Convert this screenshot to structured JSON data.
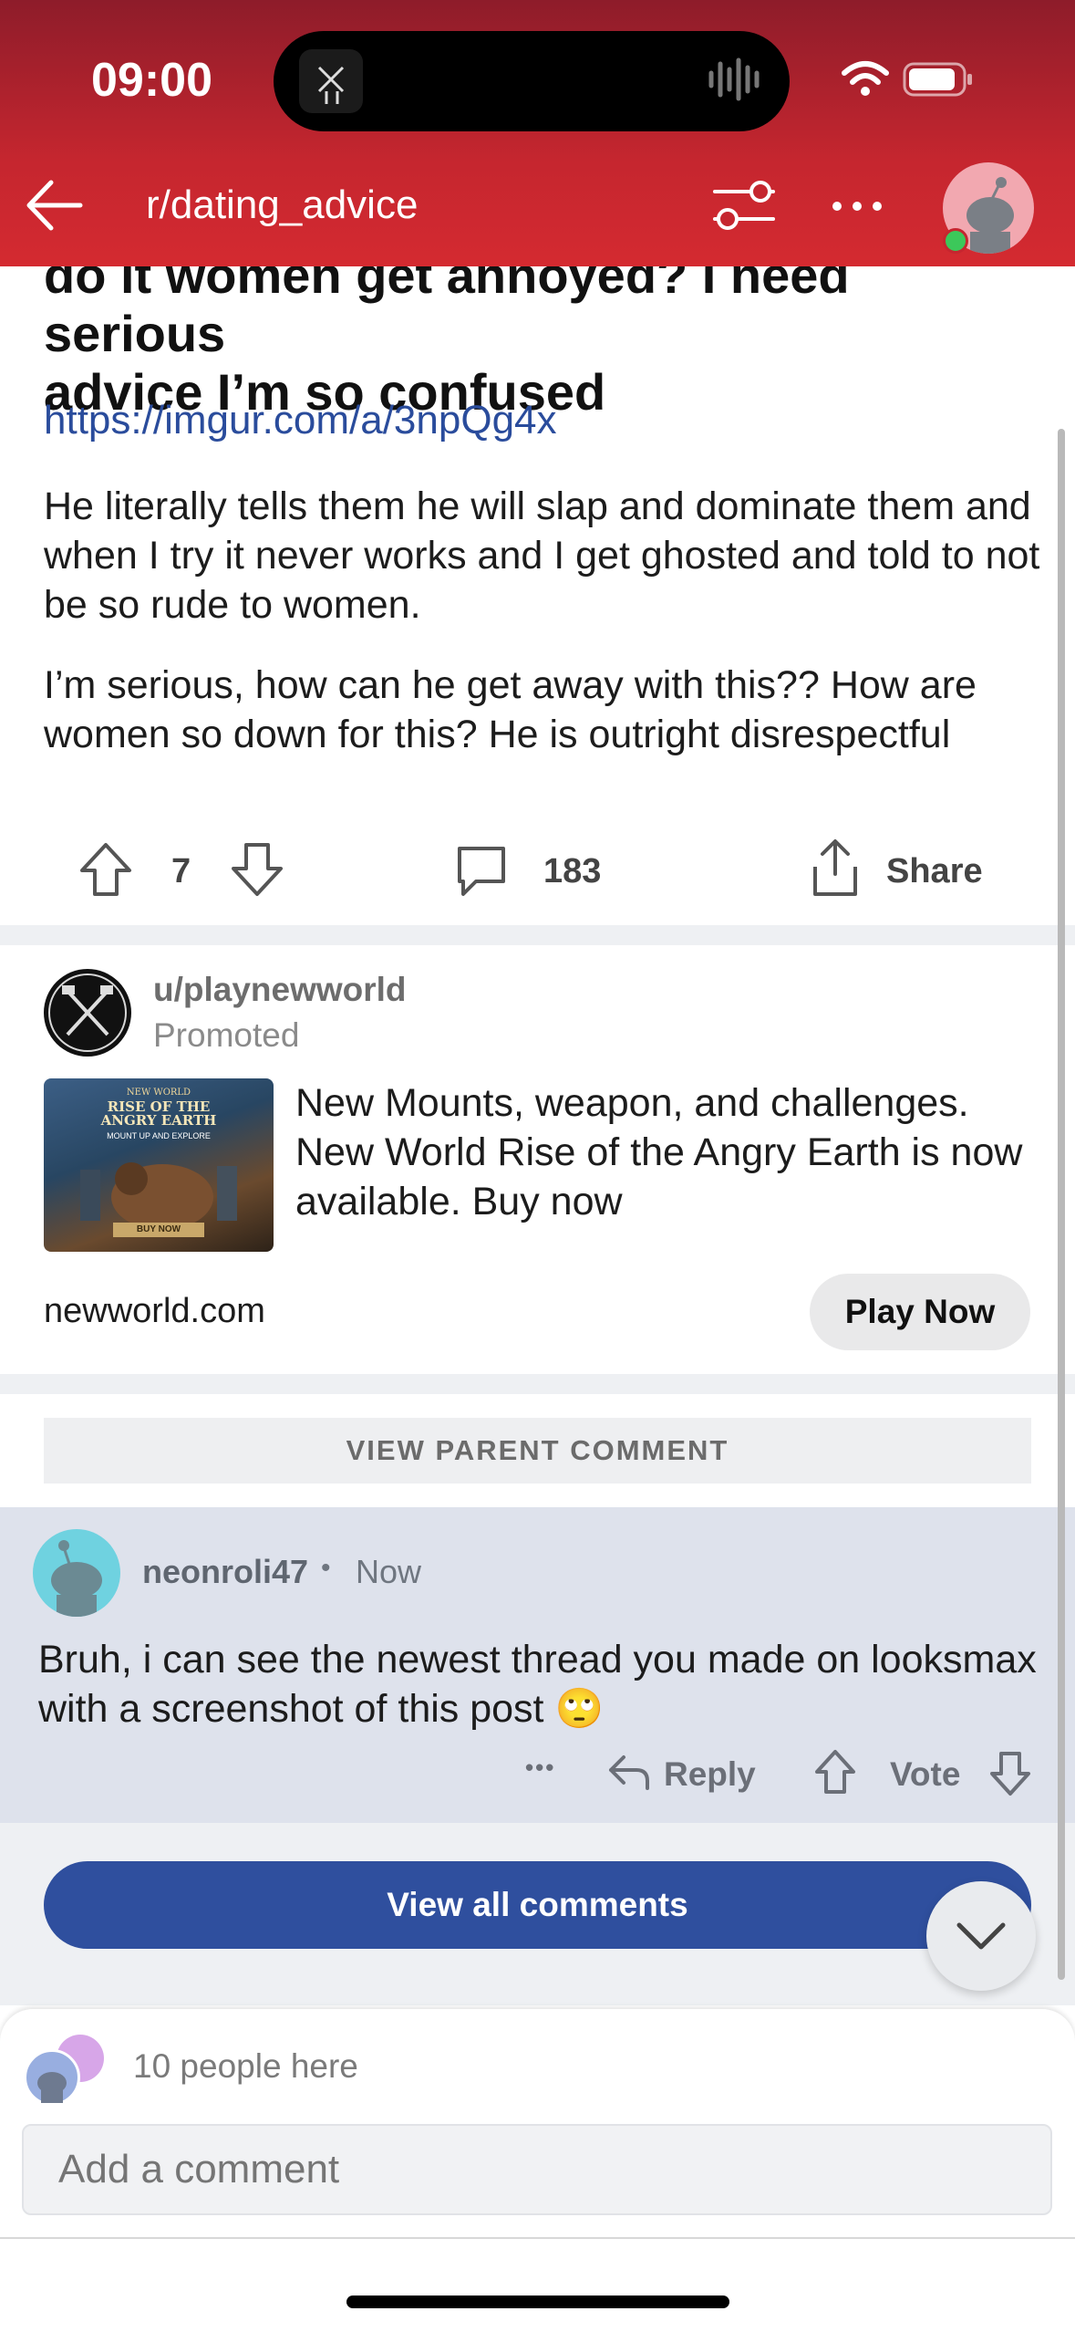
{
  "status_bar": {
    "time": "09:00"
  },
  "header": {
    "subreddit": "r/dating_advice"
  },
  "post": {
    "title_line1": "do it women get annoyed? I need serious",
    "title_line2": "advice I’m so confused",
    "link": "https://imgur.com/a/3npQg4x",
    "paragraph1": "He literally tells them he will slap and dominate them and when I try it never works and I get ghosted and told to not be so rude to women.",
    "paragraph2": "I’m serious, how can he get away with this?? How are women so down for this? He is outright disrespectful",
    "votes": "7",
    "comments": "183",
    "share_label": "Share"
  },
  "ad": {
    "user": "u/playnewworld",
    "promoted_label": "Promoted",
    "image_caption_top": "NEW WORLD",
    "image_caption_title": "RISE OF THE ANGRY EARTH",
    "image_caption_sub": "MOUNT UP AND EXPLORE",
    "image_cta": "BUY NOW",
    "text": "New Mounts, weapon, and challenges. New World Rise of the Angry Earth is now available. Buy now",
    "domain": "newworld.com",
    "button_label": "Play Now"
  },
  "view_parent_label": "VIEW PARENT COMMENT",
  "comment": {
    "user": "neonroli47",
    "separator": "•",
    "time": "Now",
    "text": "Bruh, i can see the newest thread you made on looksmax with a screenshot of this post 🙄",
    "more_label": "•••",
    "reply_label": "Reply",
    "vote_label": "Vote"
  },
  "view_all_label": "View all comments",
  "bottom": {
    "people_here": "10 people here",
    "comment_placeholder": "Add a comment"
  },
  "colors": {
    "header": "#c5262f",
    "link": "#2a4c9c",
    "button": "#2f4f9e",
    "comment_bg": "#dee2ec"
  }
}
